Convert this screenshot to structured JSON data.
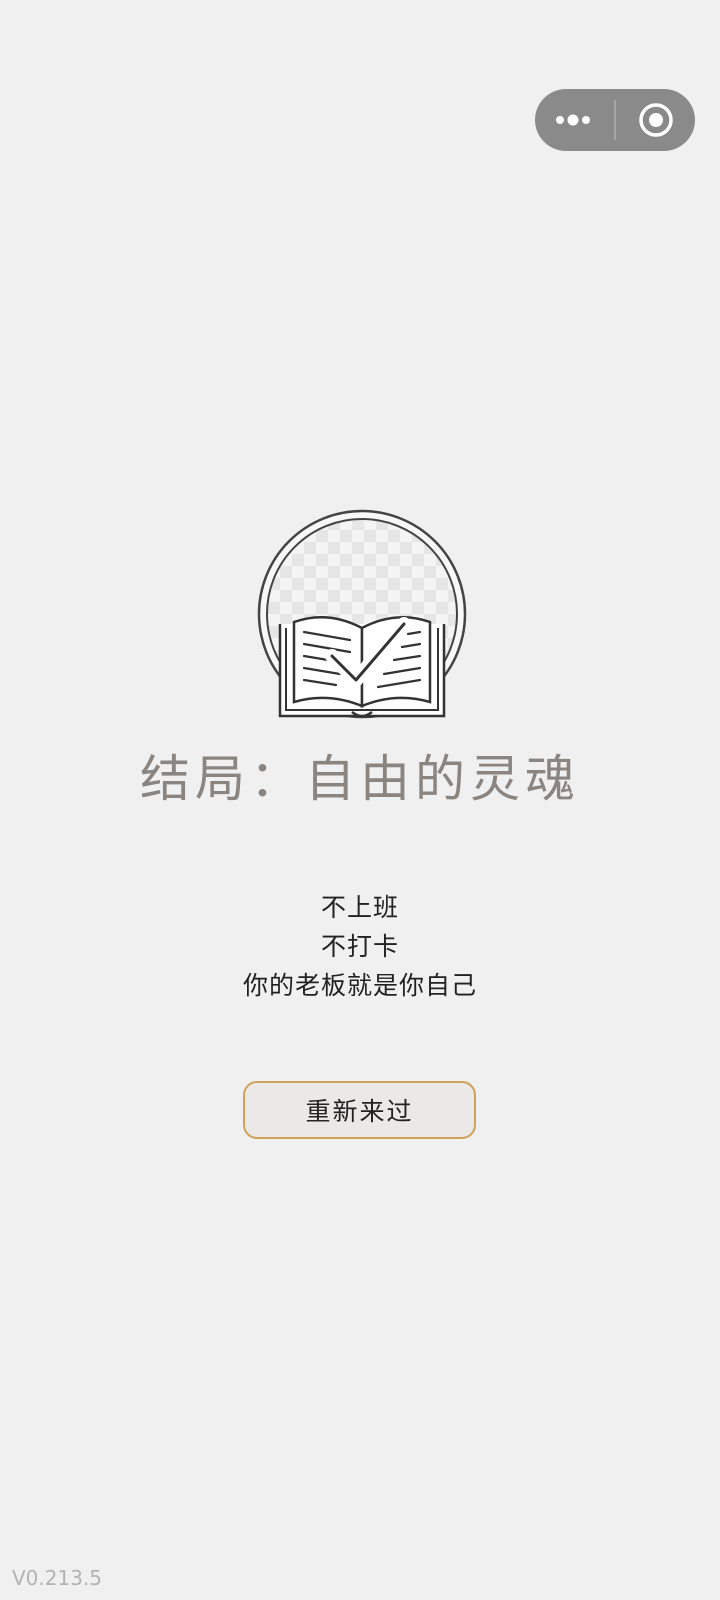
{
  "capsule": {
    "more_icon": "more-dots-icon",
    "close_icon": "target-circle-icon"
  },
  "ending": {
    "icon": "open-book-check-icon",
    "title": "结局：自由的灵魂",
    "lines": [
      "不上班",
      "不打卡",
      "你的老板就是你自己"
    ]
  },
  "actions": {
    "restart_label": "重新来过"
  },
  "footer": {
    "version": "V0.213.5"
  },
  "colors": {
    "background": "#f0f0f0",
    "title": "#8a8580",
    "button_border": "#d1a15a",
    "button_fill": "#ebe8e8",
    "capsule": "#8a8a8a"
  }
}
